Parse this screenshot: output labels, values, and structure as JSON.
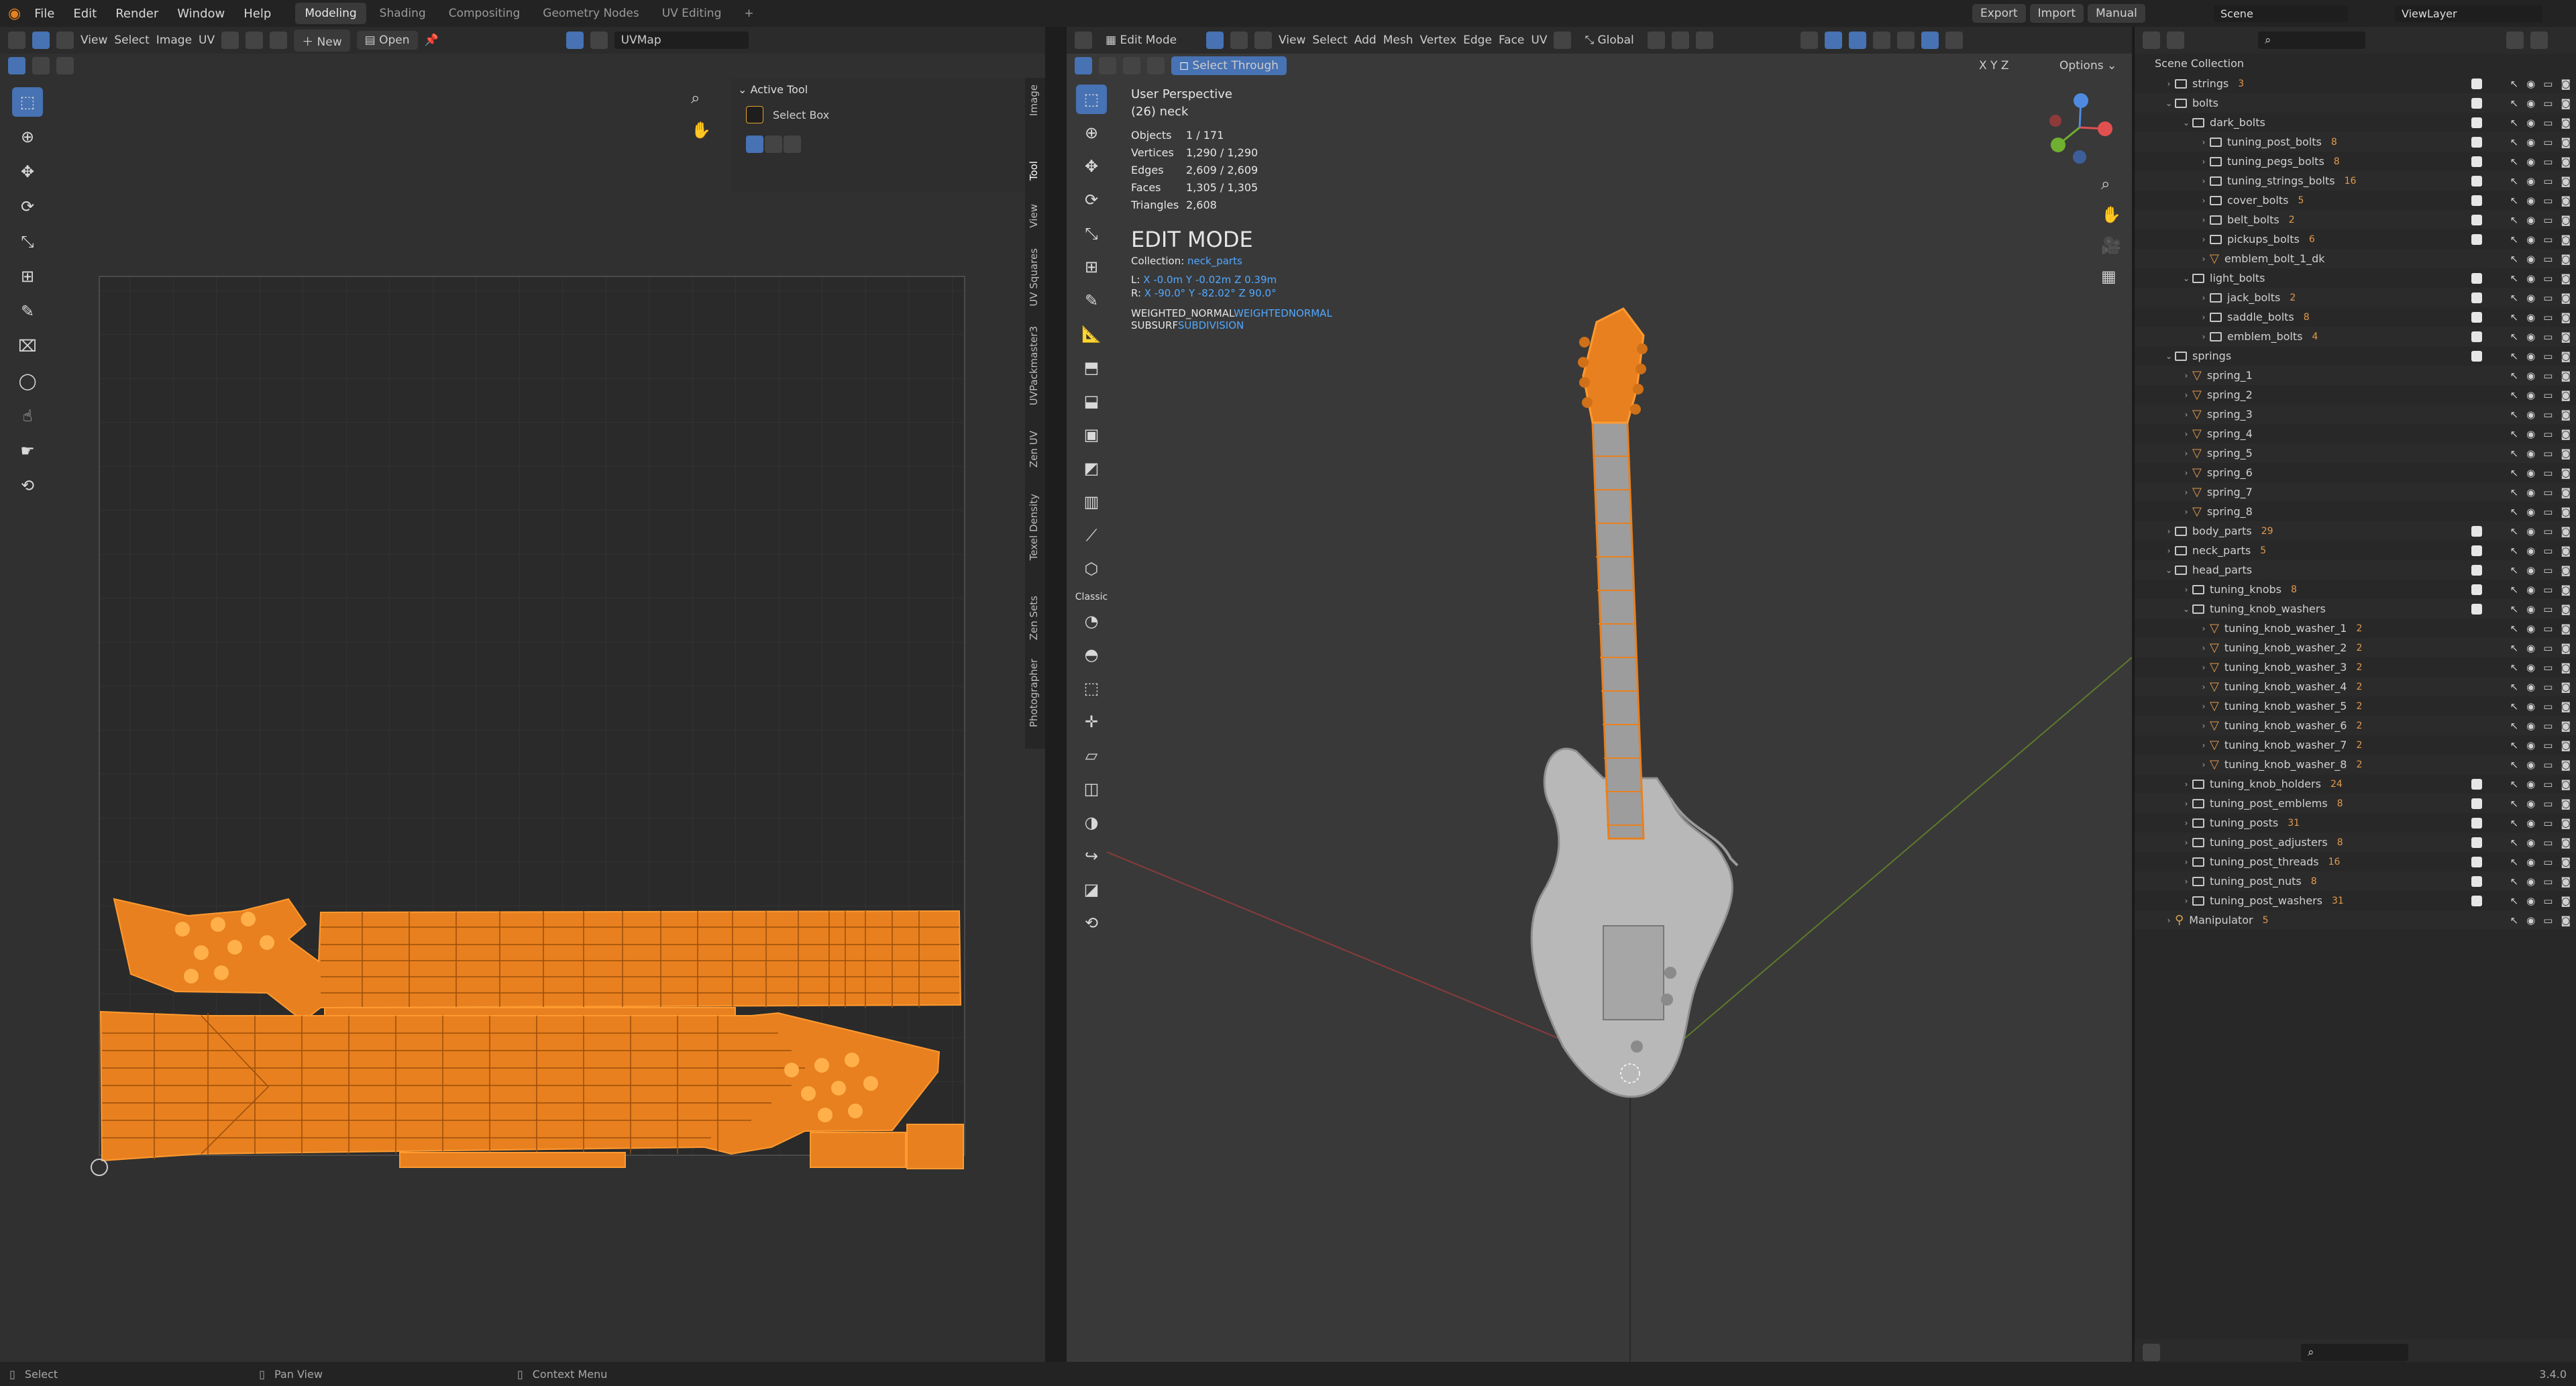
{
  "topbar": {
    "menu": [
      "File",
      "Edit",
      "Render",
      "Window",
      "Help"
    ],
    "workspaces": [
      "Modeling",
      "Shading",
      "Compositing",
      "Geometry Nodes",
      "UV Editing"
    ],
    "active_workspace": "Modeling",
    "add_tab": "+",
    "export_label": "Export",
    "import_label": "Import",
    "manual_label": "Manual",
    "scene_label": "Scene",
    "viewlayer_label": "ViewLayer"
  },
  "uv_editor": {
    "header_menus": [
      "View",
      "Select",
      "Image",
      "UV"
    ],
    "new_label": "New",
    "open_label": "Open",
    "uvmap_label": "UVMap",
    "panel_title": "Active Tool",
    "tool_name": "Select Box",
    "side_tabs": [
      "Image",
      "Tool",
      "View",
      "UV Squares",
      "UVPackmaster3",
      "Zen UV",
      "Texel Density",
      "Zen Sets",
      "Photographer"
    ]
  },
  "viewport": {
    "mode_label": "Edit Mode",
    "header_menus": [
      "View",
      "Select",
      "Add",
      "Mesh",
      "Vertex",
      "Edge",
      "Face",
      "UV"
    ],
    "orientation_label": "Global",
    "select_through_label": "Select Through",
    "options_label": "Options",
    "axis_labels": [
      "X",
      "Y",
      "Z"
    ],
    "perspective": "User Perspective",
    "object_name": "(26) neck",
    "stats": [
      {
        "label": "Objects",
        "value": "1 / 171"
      },
      {
        "label": "Vertices",
        "value": "1,290 / 1,290"
      },
      {
        "label": "Edges",
        "value": "2,609 / 2,609"
      },
      {
        "label": "Faces",
        "value": "1,305 / 1,305"
      },
      {
        "label": "Triangles",
        "value": "2,608"
      }
    ],
    "edit_mode_title": "EDIT MODE",
    "collection_prefix": "Collection:",
    "collection_name": "neck_parts",
    "loc_prefix": "L:",
    "loc_x": "X -0.0m",
    "loc_y": "Y -0.02m",
    "loc_z": "Z 0.39m",
    "rot_prefix": "R:",
    "rot_x": "X -90.0°",
    "rot_y": "Y -82.02°",
    "rot_z": "Z 90.0°",
    "modifier_1_name": "WEIGHTED_NORMAL",
    "modifier_1_type": "WEIGHTEDNORMAL",
    "modifier_2_name": "SUBSURF",
    "modifier_2_type": "SUBDIVISION",
    "toolbar_label": "Classic"
  },
  "outliner": {
    "root": "Scene Collection",
    "rows": [
      {
        "label": "strings",
        "depth": 1,
        "kind": "coll",
        "open": false,
        "badge": "3"
      },
      {
        "label": "bolts",
        "depth": 1,
        "kind": "coll",
        "open": true,
        "badge": ""
      },
      {
        "label": "dark_bolts",
        "depth": 2,
        "kind": "coll",
        "open": true,
        "badge": ""
      },
      {
        "label": "tuning_post_bolts",
        "depth": 3,
        "kind": "coll",
        "open": false,
        "badge": "8"
      },
      {
        "label": "tuning_pegs_bolts",
        "depth": 3,
        "kind": "coll",
        "open": false,
        "badge": "8"
      },
      {
        "label": "tuning_strings_bolts",
        "depth": 3,
        "kind": "coll",
        "open": false,
        "badge": "16"
      },
      {
        "label": "cover_bolts",
        "depth": 3,
        "kind": "coll",
        "open": false,
        "badge": "5"
      },
      {
        "label": "belt_bolts",
        "depth": 3,
        "kind": "coll",
        "open": false,
        "badge": "2"
      },
      {
        "label": "pickups_bolts",
        "depth": 3,
        "kind": "coll",
        "open": false,
        "badge": "6"
      },
      {
        "label": "emblem_bolt_1_dk",
        "depth": 3,
        "kind": "mesh",
        "open": false,
        "badge": ""
      },
      {
        "label": "light_bolts",
        "depth": 2,
        "kind": "coll",
        "open": true,
        "badge": ""
      },
      {
        "label": "jack_bolts",
        "depth": 3,
        "kind": "coll",
        "open": false,
        "badge": "2"
      },
      {
        "label": "saddle_bolts",
        "depth": 3,
        "kind": "coll",
        "open": false,
        "badge": "8"
      },
      {
        "label": "emblem_bolts",
        "depth": 3,
        "kind": "coll",
        "open": false,
        "badge": "4"
      },
      {
        "label": "springs",
        "depth": 1,
        "kind": "coll",
        "open": true,
        "badge": ""
      },
      {
        "label": "spring_1",
        "depth": 2,
        "kind": "mesh",
        "open": false,
        "badge": ""
      },
      {
        "label": "spring_2",
        "depth": 2,
        "kind": "mesh",
        "open": false,
        "badge": ""
      },
      {
        "label": "spring_3",
        "depth": 2,
        "kind": "mesh",
        "open": false,
        "badge": ""
      },
      {
        "label": "spring_4",
        "depth": 2,
        "kind": "mesh",
        "open": false,
        "badge": ""
      },
      {
        "label": "spring_5",
        "depth": 2,
        "kind": "mesh",
        "open": false,
        "badge": ""
      },
      {
        "label": "spring_6",
        "depth": 2,
        "kind": "mesh",
        "open": false,
        "badge": ""
      },
      {
        "label": "spring_7",
        "depth": 2,
        "kind": "mesh",
        "open": false,
        "badge": ""
      },
      {
        "label": "spring_8",
        "depth": 2,
        "kind": "mesh",
        "open": false,
        "badge": ""
      },
      {
        "label": "body_parts",
        "depth": 1,
        "kind": "coll",
        "open": false,
        "badge": "29"
      },
      {
        "label": "neck_parts",
        "depth": 1,
        "kind": "coll",
        "open": false,
        "badge": "5"
      },
      {
        "label": "head_parts",
        "depth": 1,
        "kind": "coll",
        "open": true,
        "badge": ""
      },
      {
        "label": "tuning_knobs",
        "depth": 2,
        "kind": "coll",
        "open": false,
        "badge": "8"
      },
      {
        "label": "tuning_knob_washers",
        "depth": 2,
        "kind": "coll",
        "open": true,
        "badge": ""
      },
      {
        "label": "tuning_knob_washer_1",
        "depth": 3,
        "kind": "mesh",
        "open": false,
        "badge": "2"
      },
      {
        "label": "tuning_knob_washer_2",
        "depth": 3,
        "kind": "mesh",
        "open": false,
        "badge": "2"
      },
      {
        "label": "tuning_knob_washer_3",
        "depth": 3,
        "kind": "mesh",
        "open": false,
        "badge": "2"
      },
      {
        "label": "tuning_knob_washer_4",
        "depth": 3,
        "kind": "mesh",
        "open": false,
        "badge": "2"
      },
      {
        "label": "tuning_knob_washer_5",
        "depth": 3,
        "kind": "mesh",
        "open": false,
        "badge": "2"
      },
      {
        "label": "tuning_knob_washer_6",
        "depth": 3,
        "kind": "mesh",
        "open": false,
        "badge": "2"
      },
      {
        "label": "tuning_knob_washer_7",
        "depth": 3,
        "kind": "mesh",
        "open": false,
        "badge": "2"
      },
      {
        "label": "tuning_knob_washer_8",
        "depth": 3,
        "kind": "mesh",
        "open": false,
        "badge": "2"
      },
      {
        "label": "tuning_knob_holders",
        "depth": 2,
        "kind": "coll",
        "open": false,
        "badge": "24"
      },
      {
        "label": "tuning_post_emblems",
        "depth": 2,
        "kind": "coll",
        "open": false,
        "badge": "8"
      },
      {
        "label": "tuning_posts",
        "depth": 2,
        "kind": "coll",
        "open": false,
        "badge": "31"
      },
      {
        "label": "tuning_post_adjusters",
        "depth": 2,
        "kind": "coll",
        "open": false,
        "badge": "8"
      },
      {
        "label": "tuning_post_threads",
        "depth": 2,
        "kind": "coll",
        "open": false,
        "badge": "16"
      },
      {
        "label": "tuning_post_nuts",
        "depth": 2,
        "kind": "coll",
        "open": false,
        "badge": "8"
      },
      {
        "label": "tuning_post_washers",
        "depth": 2,
        "kind": "coll",
        "open": false,
        "badge": "31"
      },
      {
        "label": "Manipulator",
        "depth": 1,
        "kind": "armature",
        "open": false,
        "badge": "5"
      }
    ]
  },
  "statusbar": {
    "select_label": "Select",
    "pan_label": "Pan View",
    "context_label": "Context Menu",
    "version": "3.4.0"
  },
  "colors": {
    "accent": "#4772b3",
    "uv_orange": "#e8801f",
    "mesh_icon": "#e39a4c",
    "link_blue": "#52a8ff"
  }
}
